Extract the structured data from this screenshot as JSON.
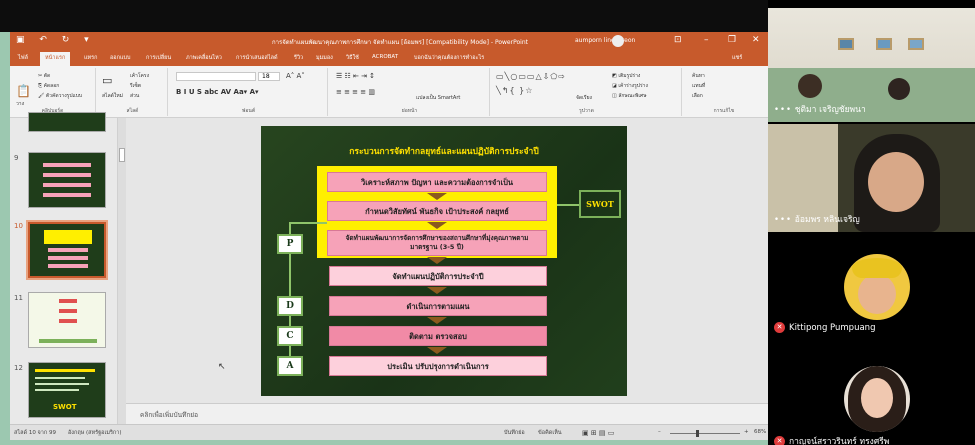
{
  "ppt": {
    "window_title": "การจัดทำแผนพัฒนาคุณภาพการศึกษา จัดทำแผน [อ้อมพร] [Compatibility Mode] - PowerPoint",
    "user_name": "aumporn linchareon",
    "tabs": [
      "ไฟล์",
      "หน้าแรก",
      "แทรก",
      "ออกแบบ",
      "การเปลี่ยน",
      "ภาพเคลื่อนไหว",
      "การนำเสนอสไลด์",
      "รีวิว",
      "มุมมอง",
      "วิธีใช้",
      "ACROBAT",
      "บอกฉันว่าคุณต้องการทำอะไร"
    ],
    "share_label": "แชร์",
    "ribbon": {
      "clipboard": "คลิปบอร์ด",
      "paste": "วาง",
      "slides": "สไลด์",
      "new_slide": "สไลด์ใหม่",
      "layout": "เค้าโครง",
      "reset": "รีเซ็ต",
      "section": "ส่วน",
      "font": "ฟอนต์",
      "font_size": "18",
      "paragraph": "ย่อหน้า",
      "drawing": "รูปวาด",
      "arrange": "จัดเรียง",
      "editing": "การแก้ไข",
      "find": "ค้นหา",
      "replace": "แทนที่",
      "select": "เลือก",
      "convert_smartart": "แปลงเป็น SmartArt"
    },
    "thumbnails": [
      {
        "num": "9"
      },
      {
        "num": "10"
      },
      {
        "num": "11"
      },
      {
        "num": "12",
        "label": "SWOT"
      }
    ],
    "notes_placeholder": "คลิกเพื่อเพิ่มบันทึกย่อ",
    "status": {
      "slide_of": "สไลด์ 10 จาก 99",
      "language": "อังกฤษ (สหรัฐอเมริกา)",
      "notes_btn": "บันทึกย่อ",
      "comments_btn": "ข้อคิดเห็น",
      "zoom": "68%"
    }
  },
  "slide": {
    "title": "กระบวนการจัดทำกลยุทธ์และแผนปฏิบัติการประจำปี",
    "steps": [
      "วิเคราะห์สภาพ ปัญหา และความต้องการจำเป็น",
      "กำหนดวิสัยทัศน์ พันธกิจ เป้าประสงค์ กลยุทธ์",
      "จัดทำแผนพัฒนาการจัดการศึกษาของสถานศึกษาที่มุ่งคุณภาพตามมาตรฐาน (3-5 ปี)",
      "จัดทำแผนปฏิบัติการประจำปี",
      "ดำเนินการตามแผน",
      "ติดตาม ตรวจสอบ",
      "ประเมิน ปรับปรุงการดำเนินการ"
    ],
    "pdca": [
      "P",
      "D",
      "C",
      "A"
    ],
    "swot": "SWOT"
  },
  "participants": [
    {
      "name": "ชุติมา เจริญชัยพนา",
      "muted": false
    },
    {
      "name": "อ้อมพร หลินเจริญ",
      "muted": false
    },
    {
      "name": "Kittipong Pumpuang",
      "muted": true
    },
    {
      "name": "กาญจน์สราวรินทร์ ทรงศรีพ",
      "muted": true
    }
  ],
  "colors": {
    "ppt_accent": "#c75a2c",
    "slide_bg": "#1e3b1a",
    "step_pink": "#f6a2b8",
    "highlight_yellow": "#ffef00"
  }
}
